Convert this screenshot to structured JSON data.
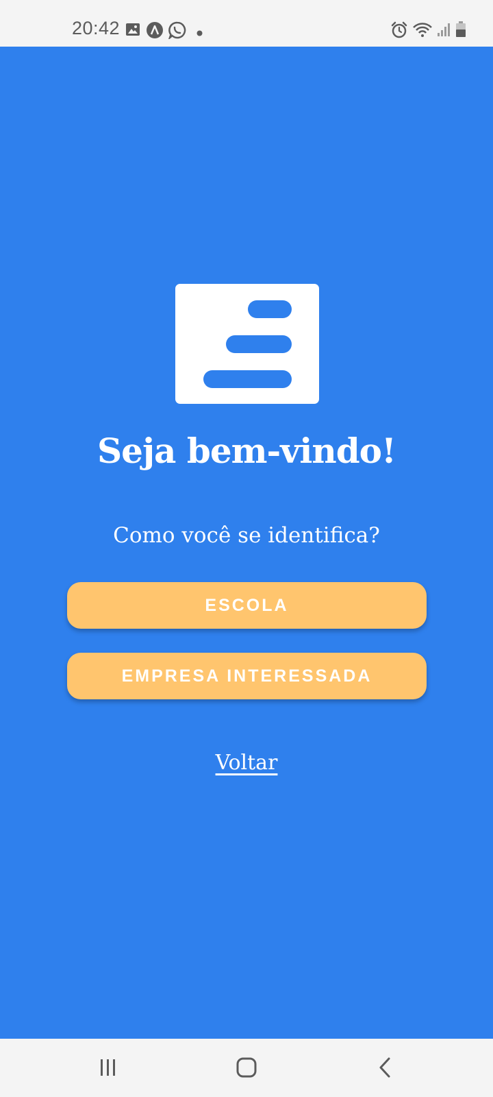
{
  "status_bar": {
    "time": "20:42",
    "left_icons": [
      "image-icon",
      "app-notification-icon",
      "whatsapp-icon",
      "dot-icon"
    ],
    "right_icons": [
      "alarm-icon",
      "wifi-icon",
      "signal-icon",
      "battery-icon"
    ]
  },
  "colors": {
    "background": "#2f80ed",
    "button": "#ffc56e",
    "text": "#ffffff",
    "system_bar": "#f4f4f4"
  },
  "welcome": {
    "logo_icon": "document-lines-icon",
    "title": "Seja bem-vindo!",
    "question": "Como você se identifica?"
  },
  "buttons": {
    "escola": "ESCOLA",
    "empresa": "EMPRESA INTERESSADA"
  },
  "links": {
    "voltar": "Voltar"
  },
  "nav_bar": {
    "icons": [
      "recent-apps-icon",
      "home-icon",
      "back-icon"
    ]
  }
}
